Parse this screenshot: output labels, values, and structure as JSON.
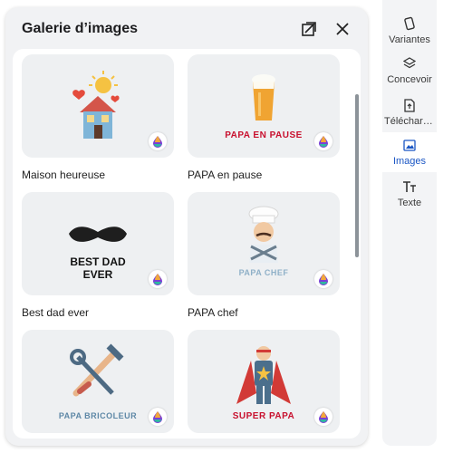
{
  "panel": {
    "title": "Galerie d’images"
  },
  "gallery": [
    {
      "label": "Maison heureuse",
      "caption": ""
    },
    {
      "label": "PAPA en pause",
      "caption": "PAPA EN PAUSE"
    },
    {
      "label": "Best dad ever",
      "caption_line1": "BEST DAD",
      "caption_line2": "EVER"
    },
    {
      "label": "PAPA chef",
      "caption": "PAPA CHEF"
    },
    {
      "label": "",
      "caption": "PAPA BRICOLEUR"
    },
    {
      "label": "",
      "caption": "SUPER PAPA"
    }
  ],
  "sidebar": {
    "items": [
      {
        "label": "Variantes",
        "icon": "phone-rotate-icon"
      },
      {
        "label": "Concevoir",
        "icon": "layers-icon"
      },
      {
        "label": "Télécharger",
        "icon": "upload-file-icon"
      },
      {
        "label": "Images",
        "icon": "image-icon"
      },
      {
        "label": "Texte",
        "icon": "text-icon"
      }
    ],
    "active": "Images"
  },
  "colors": {
    "accent": "#1a56c4",
    "caption_red": "#c8102e",
    "caption_steel": "#5d87a6"
  }
}
